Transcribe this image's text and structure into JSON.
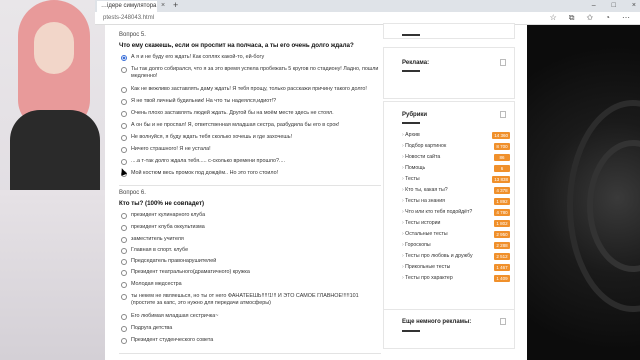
{
  "browser": {
    "tab_title": "…ідере симулятора – ",
    "url": "ptests-248043.html"
  },
  "questions": [
    {
      "num": "Вопрос 5.",
      "title": "Что ему скажешь, если он проспит на полчаса, а ты его очень долго ждала?",
      "options": [
        "А я и не буду его ждать! Как соплях какой-то, ей-богу",
        "Ты так долго собирался, что я за это время успела пробежать 5 кругов по стадиону! Ладно, пошли медленно!",
        "Как не вежливо заставлять даму ждать! Я тебя прощу, только расскажи причину такого долго!",
        "Я не твой личный будильник! На что ты надеялся,идиот!?",
        "Очень плохо заставлять людей ждать. Другой бы на моём месте здесь не стоял.",
        "А он бы и не проспал! Я, ответственная младшая сестра, разбудила бы его в срок!",
        "Не волнуйся, я буду ждать тебя сколько хочешь и где захочешь!",
        "Ничего страшного! Я не устала!",
        "....а т-так долго ждала тебя..... с-сколько времени прошло?....",
        "Мой костюм весь промок под дождём.. Но это того стоило!"
      ]
    },
    {
      "num": "Вопрос 6.",
      "title": "Кто ты? (100% не совпадет)",
      "options": [
        "президент кулинарного клуба",
        "президент клуба оккультизма",
        "заместитель учителя",
        "Главная в спорт. клубе",
        "Председатель правонарушителей",
        "Президент театрального(драматичного) кружка",
        "Молодая медсестра",
        "ты некем не являешься, но ты от него ФАНАТЕЕШЬ!!!!!1!!! И ЭТО САМОЕ ГЛАВНОЕ!!!!!101 (простите за капс, это нужно для передачи атмосферы)",
        "Его любимая младшая сестричка~",
        "Подруга детства",
        "Президент студенческого совета"
      ]
    }
  ],
  "sidebar": {
    "ads_title": "Реклама:",
    "rubrics_title": "Рубрики",
    "rubrics": [
      {
        "name": "Архив",
        "count": "14 360"
      },
      {
        "name": "Подбор картинок",
        "count": "8 700"
      },
      {
        "name": "Новости сайта",
        "count": "86"
      },
      {
        "name": "Помощь",
        "count": "6"
      },
      {
        "name": "Тесты",
        "count": "13 838"
      },
      {
        "name": "Кто ты, какая ты?",
        "count": "4 378"
      },
      {
        "name": "Тесты на знания",
        "count": "1 892"
      },
      {
        "name": "Что или кто тебя подойдёт?",
        "count": "4 780"
      },
      {
        "name": "Тесты истории",
        "count": "1 802"
      },
      {
        "name": "Остальные тесты",
        "count": "2 950"
      },
      {
        "name": "Гороскопы",
        "count": "2 288"
      },
      {
        "name": "Тесты про любовь и дружбу",
        "count": "2 512"
      },
      {
        "name": "Прикольные тесты",
        "count": "1 467"
      },
      {
        "name": "Тесты про характер",
        "count": "1 409"
      }
    ],
    "mass_ads_title": "Еще немного рекламы:"
  },
  "colors": {
    "accent": "#f0902b",
    "radio_selected": "#3a6fd8"
  },
  "icons": {
    "new_tab": "plus-icon",
    "close_tab": "close-icon"
  }
}
